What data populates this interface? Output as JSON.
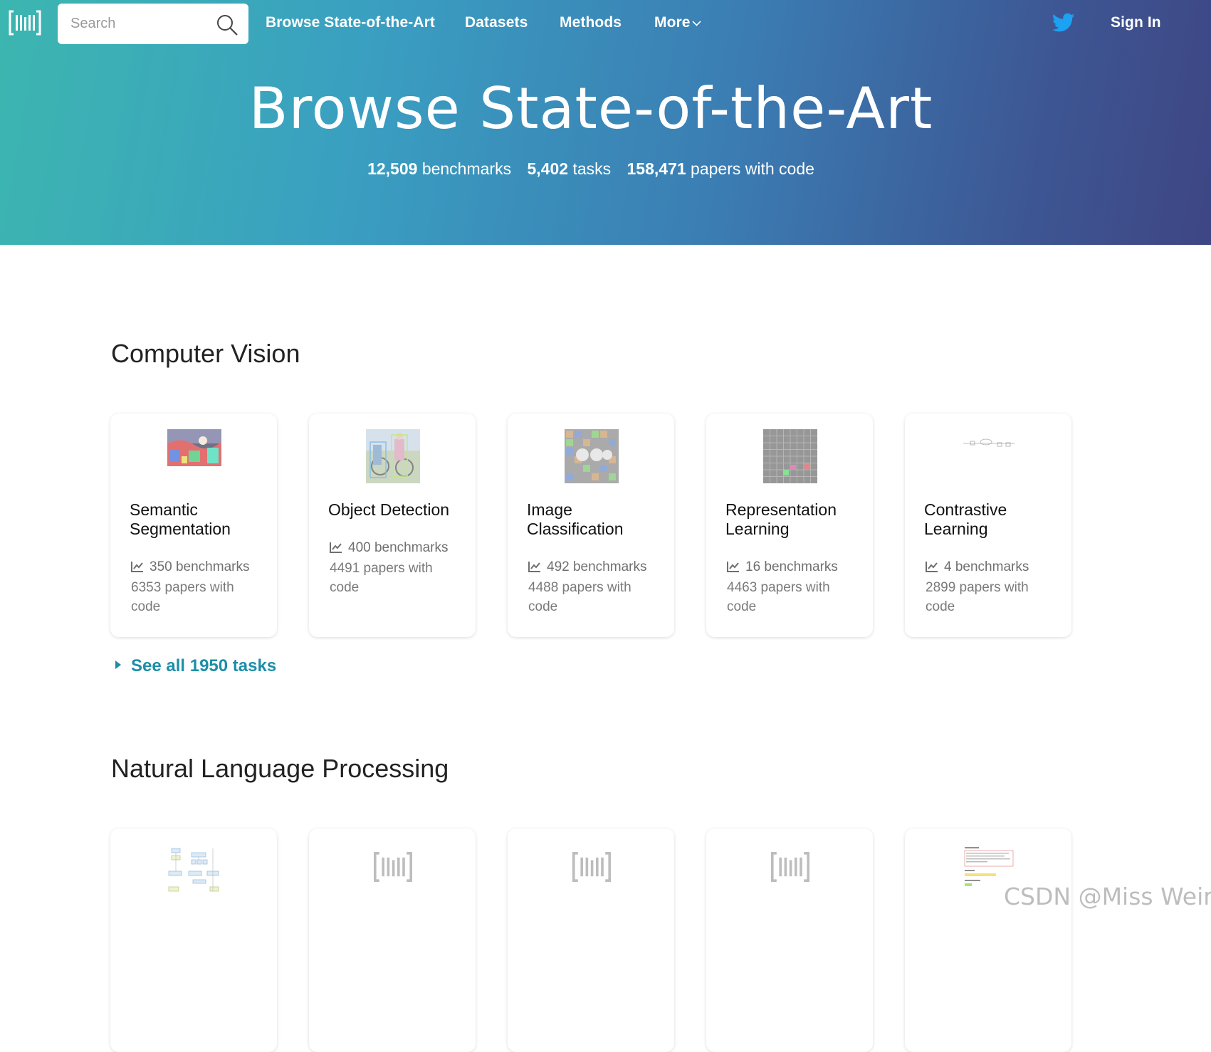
{
  "header": {
    "search_placeholder": "Search",
    "nav": {
      "browse": "Browse State-of-the-Art",
      "datasets": "Datasets",
      "methods": "Methods",
      "more": "More",
      "sign_in": "Sign In"
    }
  },
  "hero": {
    "title": "Browse State-of-the-Art",
    "stats": [
      {
        "value": "12,509",
        "label": "benchmarks"
      },
      {
        "value": "5,402",
        "label": "tasks"
      },
      {
        "value": "158,471",
        "label": "papers with code"
      }
    ]
  },
  "sections": {
    "cv": {
      "title": "Computer Vision",
      "see_all": "See all 1950 tasks",
      "cards": [
        {
          "name": "Semantic Segmentation",
          "benchmarks": "350 benchmarks",
          "papers": "6353 papers with code"
        },
        {
          "name": "Object Detection",
          "benchmarks": "400 benchmarks",
          "papers": "4491 papers with code"
        },
        {
          "name": "Image Classification",
          "benchmarks": "492 benchmarks",
          "papers": "4488 papers with code"
        },
        {
          "name": "Representation Learning",
          "benchmarks": "16 benchmarks",
          "papers": "4463 papers with code"
        },
        {
          "name": "Contrastive Learning",
          "benchmarks": "4 benchmarks",
          "papers": "2899 papers with code"
        }
      ]
    },
    "nlp": {
      "title": "Natural Language Processing"
    }
  },
  "watermark": "CSDN @Miss Weird",
  "colors": {
    "gradient_start": "#3cb6b0",
    "gradient_end": "#3e4684",
    "link": "#1c8ea8",
    "twitter": "#1da1f2"
  }
}
